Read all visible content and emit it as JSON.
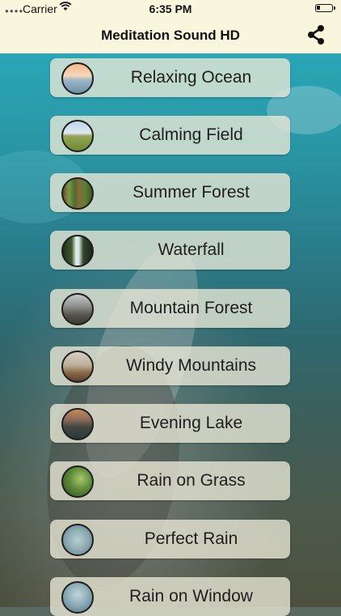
{
  "status_bar": {
    "carrier": "Carrier",
    "time": "6:35 PM"
  },
  "nav": {
    "title": "Meditation Sound HD",
    "share_icon": "share-icon"
  },
  "sounds": [
    {
      "label": "Relaxing Ocean",
      "thumb": "ocean-thumbnail"
    },
    {
      "label": "Calming Field",
      "thumb": "field-thumbnail"
    },
    {
      "label": "Summer Forest",
      "thumb": "forest-thumbnail"
    },
    {
      "label": "Waterfall",
      "thumb": "waterfall-thumbnail"
    },
    {
      "label": "Mountain Forest",
      "thumb": "mountain-thumbnail"
    },
    {
      "label": "Windy Mountains",
      "thumb": "windy-mountains-thumbnail"
    },
    {
      "label": "Evening Lake",
      "thumb": "lake-thumbnail"
    },
    {
      "label": "Rain on Grass",
      "thumb": "grass-thumbnail"
    },
    {
      "label": "Perfect Rain",
      "thumb": "rain-thumbnail"
    },
    {
      "label": "Rain on Window",
      "thumb": "window-thumbnail"
    }
  ]
}
